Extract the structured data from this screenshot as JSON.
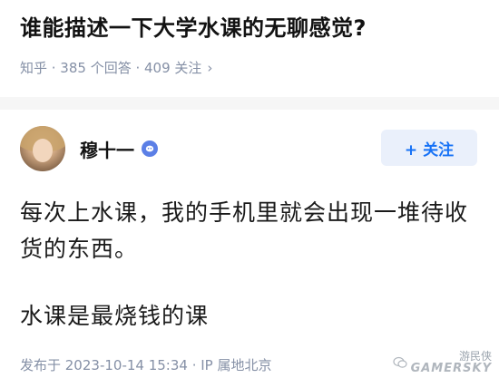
{
  "question": {
    "title": "谁能描述一下大学水课的无聊感觉?",
    "meta": "知乎 · 385 个回答 · 409 关注",
    "meta_chevron": "›"
  },
  "answer": {
    "author_name": "穆十一",
    "follow_label": "+ 关注",
    "paragraphs": [
      "每次上水课，我的手机里就会出现一堆待收货的东西。",
      "水课是最烧钱的课"
    ],
    "meta": "发布于 2023-10-14 15:34 · IP 属地北京"
  },
  "watermark": {
    "channel": "游民侠",
    "brand": "GAMERSKY"
  },
  "icons": {
    "badge": "verified-badge-icon",
    "wechat": "wechat-icon",
    "chevron": "chevron-right-icon"
  },
  "colors": {
    "accent": "#1772f6",
    "meta_gray": "#8590a6",
    "badge_blue": "#5b7fe6"
  }
}
